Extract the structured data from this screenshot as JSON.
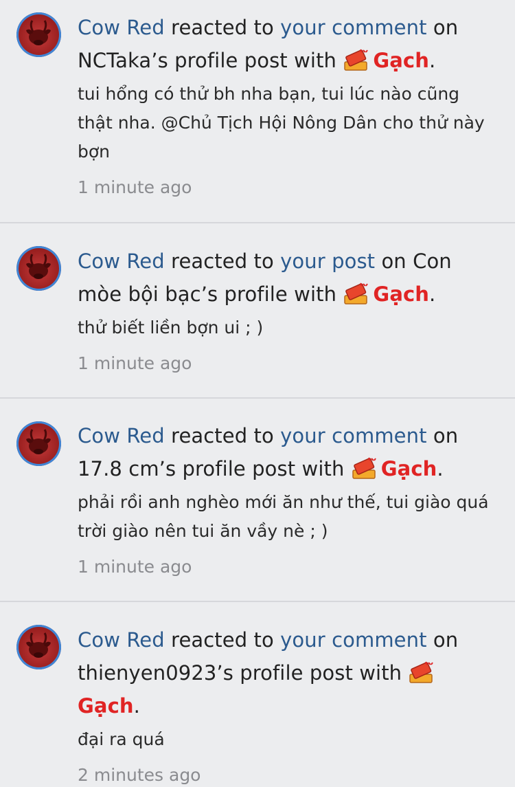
{
  "colors": {
    "background": "#ecedef",
    "divider": "#d6d7db",
    "link": "#2b5a8e",
    "reaction": "#e02424",
    "timestamp": "#8a8b8f"
  },
  "notifications": [
    {
      "user": "Cow Red",
      "action": " reacted to ",
      "target_link": "your comment",
      "context": " on NCTaka’s profile post with ",
      "reaction_icon": "brick-icon",
      "reaction": "Gạch",
      "period": ".",
      "snippet": "tui hổng có thử bh nha bạn, tui lúc nào cũng thật nha. @Chủ Tịch Hội Nông Dân cho thử này bợn",
      "time": "1 minute ago"
    },
    {
      "user": "Cow Red",
      "action": " reacted to ",
      "target_link": "your post",
      "context": " on Con mòe bội bạc’s profile with ",
      "reaction_icon": "brick-icon",
      "reaction": "Gạch",
      "period": ".",
      "snippet": "thử biết liền bợn ui ; )",
      "time": "1 minute ago"
    },
    {
      "user": "Cow Red",
      "action": " reacted to ",
      "target_link": "your comment",
      "context": " on 17.8 cm’s profile post with ",
      "reaction_icon": "brick-icon",
      "reaction": "Gạch",
      "period": ".",
      "snippet": "phải rồi anh nghèo mới ăn như thế, tui giào quá trời giào nên tui ăn vầy nè ; )",
      "time": "1 minute ago"
    },
    {
      "user": "Cow Red",
      "action": " reacted to ",
      "target_link": "your comment",
      "context": " on thienyen0923’s profile post with ",
      "reaction_icon": "brick-icon",
      "reaction": "Gạch",
      "period": ".",
      "snippet": "đại ra quá",
      "time": "2 minutes ago"
    }
  ]
}
